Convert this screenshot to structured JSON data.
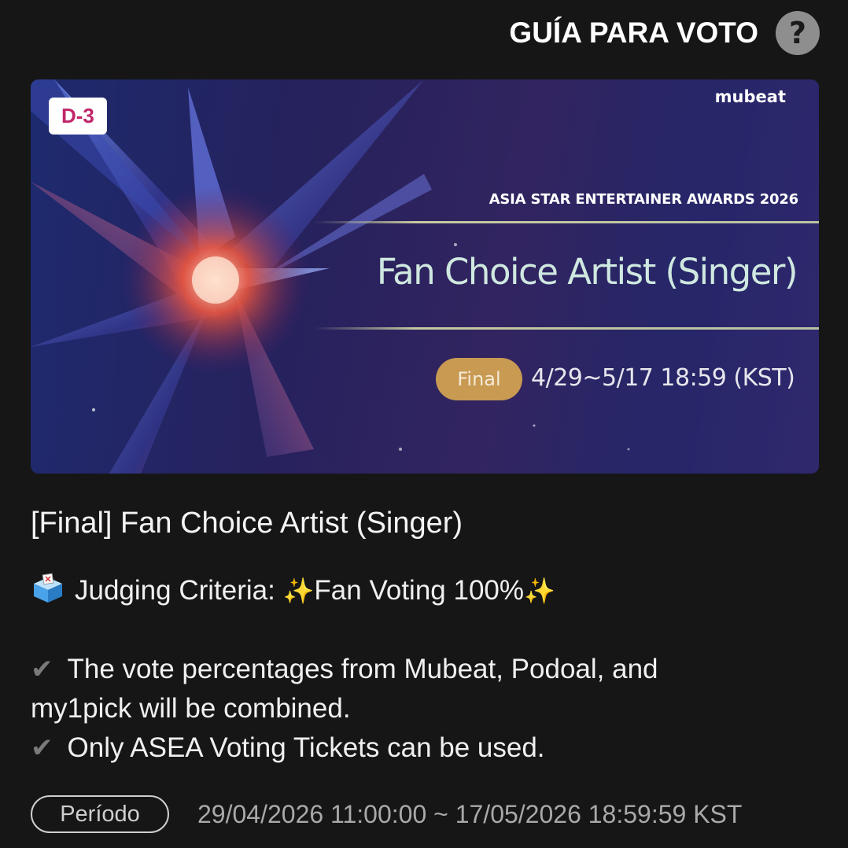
{
  "header": {
    "guide_label": "GUÍA PARA VOTO",
    "help_icon": "question-circle-icon"
  },
  "banner": {
    "dday_badge": "D-3",
    "brand": "mubeat",
    "award_name": "ASIA STAR ENTERTAINER AWARDS 2026",
    "title": "Fan Choice Artist (Singer)",
    "round_label": "Final",
    "dates": "4/29~5/17 18:59 (KST)",
    "colors": {
      "background_dark": "#1d2a6e",
      "pill": "#c89a52",
      "dday_text": "#c0266a"
    }
  },
  "vote": {
    "title": "[Final] Fan Choice Artist (Singer)",
    "criteria_label": "Judging Criteria: ",
    "criteria_value": "Fan Voting 100%",
    "criteria_icon": "ballot-box-icon",
    "sparkle_icon": "sparkles-icon",
    "notes_line1": "The vote percentages from Mubeat, Podoal, and",
    "notes_line2": "my1pick will be combined.",
    "notes_line3": "Only ASEA Voting Tickets can be used.",
    "check_icon": "check-mark-icon"
  },
  "period": {
    "label": "Período",
    "value": "29/04/2026 11:00:00 ~ 17/05/2026 18:59:59 KST"
  }
}
